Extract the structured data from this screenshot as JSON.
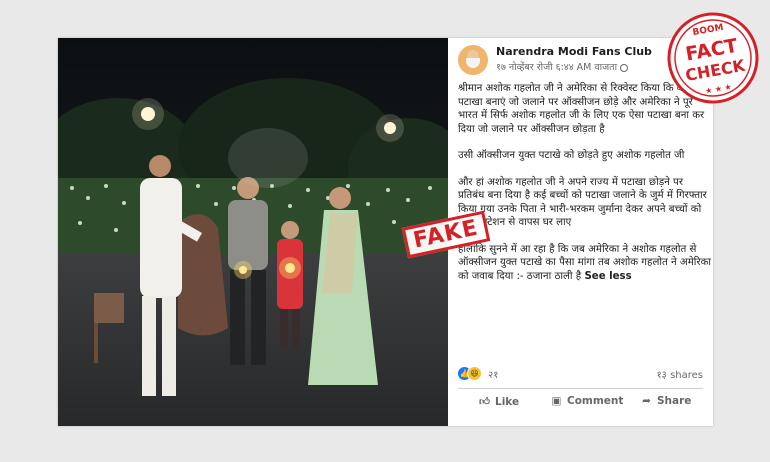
{
  "post": {
    "page_name": "Narendra Modi Fans Club",
    "timestamp": "१७ नोव्हेंबर रोजी ६:४४ AM वाजता",
    "paragraphs": [
      "श्रीमान अशोक गहलोत जी ने अमेरिका से रिक्वेस्ट किया कि वह ऐसा पटाखा बनाएं जो जलाने पर ऑक्सीजन छोड़े और अमेरिका ने पूरे भारत में सिर्फ अशोक गहलोत जी के लिए एक ऐसा पटाखा बना कर दिया जो जलाने पर ऑक्सीजन छोड़ता है",
      "उसी ऑक्सीजन युक्त पटाखे को छोड़ते हुए अशोक गहलोत जी",
      "और हां अशोक गहलोत जी ने अपने राज्य में पटाखा छोड़ने पर प्रतिबंध बना दिया है कई बच्चों को पटाखा जलाने के जुर्म में गिरफ्तार किया गया उनके पिता ने भारी-भरकम जुर्माना देकर अपने बच्चों को पुलिस स्टेशन से वापस घर लाए",
      "हालांकि सुनने में आ रहा है कि जब अमेरिका ने अशोक गहलोत से ऑक्सीजन युक्त पटाखे का पैसा मांगा तब अशोक गहलोत ने अमेरिका को जवाब दिया :- ठजाना ठाली है"
    ],
    "see_less": "See less",
    "reaction_count": "२१",
    "shares": "१३ shares",
    "actions": {
      "like": "Like",
      "comment": "Comment",
      "share": "Share"
    }
  },
  "overlays": {
    "fake_label": "FAKE",
    "stamp_brand": "BOOM",
    "stamp_line1": "FACT",
    "stamp_line2": "CHECK"
  },
  "colors": {
    "stamp_red": "#d52027",
    "link_blue": "#1877f2",
    "text_dark": "#1c1e21",
    "text_muted": "#65676b"
  },
  "icons": [
    "globe-icon",
    "like-reaction-icon",
    "haha-reaction-icon",
    "thumbs-up-icon",
    "comment-icon",
    "share-icon"
  ]
}
